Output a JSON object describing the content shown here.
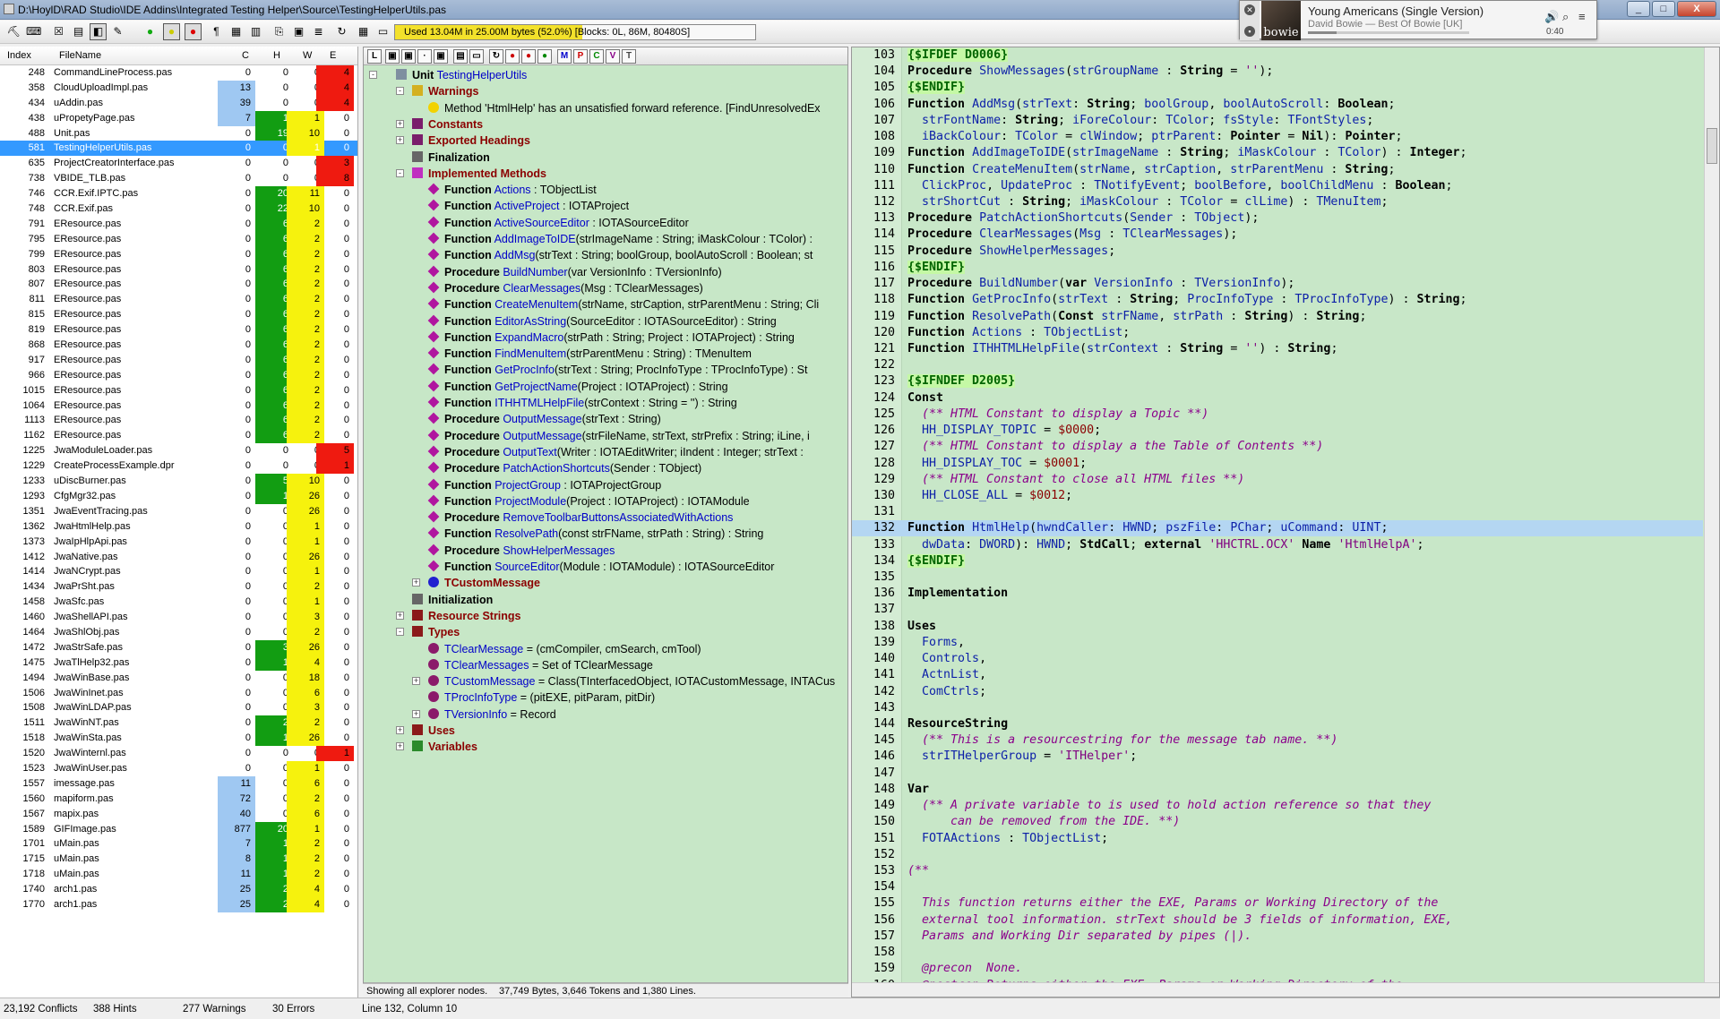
{
  "window": {
    "title": "D:\\HoylD\\RAD Studio\\IDE Addins\\Integrated Testing Helper\\Source\\TestingHelperUtils.pas",
    "controls": [
      "_",
      "□",
      "X"
    ]
  },
  "media": {
    "song": "Young Americans (Single Version)",
    "artist": "David Bowie — Best Of Bowie [UK]",
    "time": "0:40",
    "art_text": "bowie",
    "progress": 0.18
  },
  "memory": {
    "text": "Used 13.04M in 25.00M bytes (52.0%) [Blocks: 0L, 86M, 80480S]",
    "fill": 0.52
  },
  "table": {
    "headers": [
      "Index",
      "FileName",
      "C",
      "H",
      "W",
      "E"
    ],
    "rows": [
      [
        "248",
        "CommandLineProcess.pas",
        "0",
        "0",
        "0",
        "4"
      ],
      [
        "358",
        "CloudUploadImpl.pas",
        "13",
        "0",
        "0",
        "4"
      ],
      [
        "434",
        "uAddin.pas",
        "39",
        "0",
        "0",
        "4"
      ],
      [
        "438",
        "uPropetyPage.pas",
        "7",
        "1",
        "1",
        "0"
      ],
      [
        "488",
        "Unit.pas",
        "0",
        "19",
        "10",
        "0"
      ],
      [
        "581",
        "TestingHelperUtils.pas",
        "0",
        "0",
        "1",
        "0"
      ],
      [
        "635",
        "ProjectCreatorInterface.pas",
        "0",
        "0",
        "0",
        "3"
      ],
      [
        "738",
        "VBIDE_TLB.pas",
        "0",
        "0",
        "0",
        "8"
      ],
      [
        "746",
        "CCR.Exif.IPTC.pas",
        "0",
        "20",
        "11",
        "0"
      ],
      [
        "748",
        "CCR.Exif.pas",
        "0",
        "22",
        "10",
        "0"
      ],
      [
        "791",
        "EResource.pas",
        "0",
        "6",
        "2",
        "0"
      ],
      [
        "795",
        "EResource.pas",
        "0",
        "6",
        "2",
        "0"
      ],
      [
        "799",
        "EResource.pas",
        "0",
        "6",
        "2",
        "0"
      ],
      [
        "803",
        "EResource.pas",
        "0",
        "6",
        "2",
        "0"
      ],
      [
        "807",
        "EResource.pas",
        "0",
        "6",
        "2",
        "0"
      ],
      [
        "811",
        "EResource.pas",
        "0",
        "6",
        "2",
        "0"
      ],
      [
        "815",
        "EResource.pas",
        "0",
        "6",
        "2",
        "0"
      ],
      [
        "819",
        "EResource.pas",
        "0",
        "6",
        "2",
        "0"
      ],
      [
        "868",
        "EResource.pas",
        "0",
        "6",
        "2",
        "0"
      ],
      [
        "917",
        "EResource.pas",
        "0",
        "6",
        "2",
        "0"
      ],
      [
        "966",
        "EResource.pas",
        "0",
        "6",
        "2",
        "0"
      ],
      [
        "1015",
        "EResource.pas",
        "0",
        "6",
        "2",
        "0"
      ],
      [
        "1064",
        "EResource.pas",
        "0",
        "6",
        "2",
        "0"
      ],
      [
        "1113",
        "EResource.pas",
        "0",
        "6",
        "2",
        "0"
      ],
      [
        "1162",
        "EResource.pas",
        "0",
        "6",
        "2",
        "0"
      ],
      [
        "1225",
        "JwaModuleLoader.pas",
        "0",
        "0",
        "0",
        "5"
      ],
      [
        "1229",
        "CreateProcessExample.dpr",
        "0",
        "0",
        "0",
        "1"
      ],
      [
        "1233",
        "uDiscBurner.pas",
        "0",
        "5",
        "10",
        "0"
      ],
      [
        "1293",
        "CfgMgr32.pas",
        "0",
        "1",
        "26",
        "0"
      ],
      [
        "1351",
        "JwaEventTracing.pas",
        "0",
        "0",
        "26",
        "0"
      ],
      [
        "1362",
        "JwaHtmlHelp.pas",
        "0",
        "0",
        "1",
        "0"
      ],
      [
        "1373",
        "JwaIpHlpApi.pas",
        "0",
        "0",
        "1",
        "0"
      ],
      [
        "1412",
        "JwaNative.pas",
        "0",
        "0",
        "26",
        "0"
      ],
      [
        "1414",
        "JwaNCrypt.pas",
        "0",
        "0",
        "1",
        "0"
      ],
      [
        "1434",
        "JwaPrSht.pas",
        "0",
        "0",
        "2",
        "0"
      ],
      [
        "1458",
        "JwaSfc.pas",
        "0",
        "0",
        "1",
        "0"
      ],
      [
        "1460",
        "JwaShellAPI.pas",
        "0",
        "0",
        "3",
        "0"
      ],
      [
        "1464",
        "JwaShlObj.pas",
        "0",
        "0",
        "2",
        "0"
      ],
      [
        "1472",
        "JwaStrSafe.pas",
        "0",
        "3",
        "26",
        "0"
      ],
      [
        "1475",
        "JwaTlHelp32.pas",
        "0",
        "1",
        "4",
        "0"
      ],
      [
        "1494",
        "JwaWinBase.pas",
        "0",
        "0",
        "18",
        "0"
      ],
      [
        "1506",
        "JwaWinInet.pas",
        "0",
        "0",
        "6",
        "0"
      ],
      [
        "1508",
        "JwaWinLDAP.pas",
        "0",
        "0",
        "3",
        "0"
      ],
      [
        "1511",
        "JwaWinNT.pas",
        "0",
        "2",
        "2",
        "0"
      ],
      [
        "1518",
        "JwaWinSta.pas",
        "0",
        "1",
        "26",
        "0"
      ],
      [
        "1520",
        "JwaWinternl.pas",
        "0",
        "0",
        "0",
        "1"
      ],
      [
        "1523",
        "JwaWinUser.pas",
        "0",
        "0",
        "1",
        "0"
      ],
      [
        "1557",
        "imessage.pas",
        "11",
        "0",
        "6",
        "0"
      ],
      [
        "1560",
        "mapiform.pas",
        "72",
        "0",
        "2",
        "0"
      ],
      [
        "1567",
        "mapix.pas",
        "40",
        "0",
        "6",
        "0"
      ],
      [
        "1589",
        "GIFImage.pas",
        "877",
        "20",
        "1",
        "0"
      ],
      [
        "1701",
        "uMain.pas",
        "7",
        "1",
        "2",
        "0"
      ],
      [
        "1715",
        "uMain.pas",
        "8",
        "1",
        "2",
        "0"
      ],
      [
        "1718",
        "uMain.pas",
        "11",
        "1",
        "2",
        "0"
      ],
      [
        "1740",
        "arch1.pas",
        "25",
        "2",
        "4",
        "0"
      ],
      [
        "1770",
        "arch1.pas",
        "25",
        "2",
        "4",
        "0"
      ]
    ],
    "selected_index": "581"
  },
  "tree": {
    "toolbar_buttons": [
      "M",
      "P",
      "C",
      "V",
      "T"
    ],
    "root": {
      "kw": "Unit",
      "name": "TestingHelperUtils"
    },
    "nodes": [
      {
        "level": 1,
        "kind": "head",
        "text": "Warnings",
        "exp": "-",
        "icon": "folder-warning-icon"
      },
      {
        "level": 2,
        "kind": "warn",
        "text": "Method 'HtmlHelp' has an unsatisfied forward reference. [FindUnresolvedEx",
        "icon": "warning-icon"
      },
      {
        "level": 1,
        "kind": "head",
        "text": "Constants",
        "exp": "+",
        "icon": "constants-icon"
      },
      {
        "level": 1,
        "kind": "head",
        "text": "Exported Headings",
        "exp": "+",
        "icon": "exported-icon"
      },
      {
        "level": 1,
        "kind": "plain",
        "text": "Finalization",
        "exp": "",
        "icon": "finalization-icon"
      },
      {
        "level": 1,
        "kind": "head",
        "text": "Implemented Methods",
        "exp": "-",
        "icon": "methods-icon"
      },
      {
        "level": 2,
        "kind": "m",
        "kw": "Function",
        "name": "Actions",
        "rest": " : TObjectList"
      },
      {
        "level": 2,
        "kind": "m",
        "kw": "Function",
        "name": "ActiveProject",
        "rest": " : IOTAProject"
      },
      {
        "level": 2,
        "kind": "m",
        "kw": "Function",
        "name": "ActiveSourceEditor",
        "rest": " : IOTASourceEditor"
      },
      {
        "level": 2,
        "kind": "m",
        "kw": "Function",
        "name": "AddImageToIDE",
        "rest": "(strImageName : String; iMaskColour : TColor) :"
      },
      {
        "level": 2,
        "kind": "m",
        "kw": "Function",
        "name": "AddMsg",
        "rest": "(strText : String; boolGroup, boolAutoScroll : Boolean; st"
      },
      {
        "level": 2,
        "kind": "m",
        "kw": "Procedure",
        "name": "BuildNumber",
        "rest": "(var VersionInfo : TVersionInfo)"
      },
      {
        "level": 2,
        "kind": "m",
        "kw": "Procedure",
        "name": "ClearMessages",
        "rest": "(Msg : TClearMessages)"
      },
      {
        "level": 2,
        "kind": "m",
        "kw": "Function",
        "name": "CreateMenuItem",
        "rest": "(strName, strCaption, strParentMenu : String; Cli"
      },
      {
        "level": 2,
        "kind": "m",
        "kw": "Function",
        "name": "EditorAsString",
        "rest": "(SourceEditor : IOTASourceEditor) : String"
      },
      {
        "level": 2,
        "kind": "m",
        "kw": "Function",
        "name": "ExpandMacro",
        "rest": "(strPath : String; Project : IOTAProject) : String"
      },
      {
        "level": 2,
        "kind": "m",
        "kw": "Function",
        "name": "FindMenuItem",
        "rest": "(strParentMenu : String) : TMenuItem"
      },
      {
        "level": 2,
        "kind": "m",
        "kw": "Function",
        "name": "GetProcInfo",
        "rest": "(strText : String; ProcInfoType : TProcInfoType) : St"
      },
      {
        "level": 2,
        "kind": "m",
        "kw": "Function",
        "name": "GetProjectName",
        "rest": "(Project : IOTAProject) : String"
      },
      {
        "level": 2,
        "kind": "m",
        "kw": "Function",
        "name": "ITHHTMLHelpFile",
        "rest": "(strContext : String = '') : String"
      },
      {
        "level": 2,
        "kind": "m",
        "kw": "Procedure",
        "name": "OutputMessage",
        "rest": "(strText : String)"
      },
      {
        "level": 2,
        "kind": "m",
        "kw": "Procedure",
        "name": "OutputMessage",
        "rest": "(strFileName, strText, strPrefix : String; iLine, i"
      },
      {
        "level": 2,
        "kind": "m",
        "kw": "Procedure",
        "name": "OutputText",
        "rest": "(Writer : IOTAEditWriter; iIndent : Integer; strText :"
      },
      {
        "level": 2,
        "kind": "m",
        "kw": "Procedure",
        "name": "PatchActionShortcuts",
        "rest": "(Sender : TObject)"
      },
      {
        "level": 2,
        "kind": "m",
        "kw": "Function",
        "name": "ProjectGroup",
        "rest": " : IOTAProjectGroup"
      },
      {
        "level": 2,
        "kind": "m",
        "kw": "Function",
        "name": "ProjectModule",
        "rest": "(Project : IOTAProject) : IOTAModule"
      },
      {
        "level": 2,
        "kind": "m",
        "kw": "Procedure",
        "name": "RemoveToolbarButtonsAssociatedWithActions",
        "rest": ""
      },
      {
        "level": 2,
        "kind": "m",
        "kw": "Function",
        "name": "ResolvePath",
        "rest": "(const strFName, strPath : String) : String"
      },
      {
        "level": 2,
        "kind": "m",
        "kw": "Procedure",
        "name": "ShowHelperMessages",
        "rest": ""
      },
      {
        "level": 2,
        "kind": "m",
        "kw": "Function",
        "name": "SourceEditor",
        "rest": "(Module : IOTAModule) : IOTASourceEditor"
      },
      {
        "level": 2,
        "kind": "head",
        "text": "TCustomMessage",
        "exp": "+",
        "icon": "class-icon"
      },
      {
        "level": 1,
        "kind": "plain",
        "text": "Initialization",
        "exp": "",
        "icon": "initialization-icon"
      },
      {
        "level": 1,
        "kind": "head",
        "text": "Resource Strings",
        "exp": "+",
        "icon": "resource-icon"
      },
      {
        "level": 1,
        "kind": "head",
        "text": "Types",
        "exp": "-",
        "icon": "types-icon"
      },
      {
        "level": 2,
        "kind": "t",
        "name": "TClearMessage",
        "rest": " = (cmCompiler, cmSearch, cmTool)"
      },
      {
        "level": 2,
        "kind": "t",
        "name": "TClearMessages",
        "rest": " = Set of TClearMessage"
      },
      {
        "level": 2,
        "kind": "t",
        "name": "TCustomMessage",
        "rest": " = Class(TInterfacedObject, IOTACustomMessage, INTACus",
        "exp": "+"
      },
      {
        "level": 2,
        "kind": "t",
        "name": "TProcInfoType",
        "rest": " = (pitEXE, pitParam, pitDir)"
      },
      {
        "level": 2,
        "kind": "t",
        "name": "TVersionInfo",
        "rest": " = Record",
        "exp": "+"
      },
      {
        "level": 1,
        "kind": "head",
        "text": "Uses",
        "exp": "+",
        "icon": "uses-icon"
      },
      {
        "level": 1,
        "kind": "head",
        "text": "Variables",
        "exp": "+",
        "icon": "variables-icon"
      }
    ],
    "status": "Showing all explorer nodes."
  },
  "editor": {
    "info": "37,749 Bytes, 3,646 Tokens and 1,380 Lines.",
    "current_line": 132,
    "lines": [
      [
        103,
        "{$IFDEF D0006}"
      ],
      [
        104,
        "Procedure ShowMessages(strGroupName : String = '');"
      ],
      [
        105,
        "{$ENDIF}"
      ],
      [
        106,
        "Function AddMsg(strText: String; boolGroup, boolAutoScroll: Boolean;"
      ],
      [
        107,
        "  strFontName: String; iForeColour: TColor; fsStyle: TFontStyles;"
      ],
      [
        108,
        "  iBackColour: TColor = clWindow; ptrParent: Pointer = Nil): Pointer;"
      ],
      [
        109,
        "Function AddImageToIDE(strImageName : String; iMaskColour : TColor) : Integer;"
      ],
      [
        110,
        "Function CreateMenuItem(strName, strCaption, strParentMenu : String;"
      ],
      [
        111,
        "  ClickProc, UpdateProc : TNotifyEvent; boolBefore, boolChildMenu : Boolean;"
      ],
      [
        112,
        "  strShortCut : String; iMaskColour : TColor = clLime) : TMenuItem;"
      ],
      [
        113,
        "Procedure PatchActionShortcuts(Sender : TObject);"
      ],
      [
        114,
        "Procedure ClearMessages(Msg : TClearMessages);"
      ],
      [
        115,
        "Procedure ShowHelperMessages;"
      ],
      [
        116,
        "{$ENDIF}"
      ],
      [
        117,
        "Procedure BuildNumber(var VersionInfo : TVersionInfo);"
      ],
      [
        118,
        "Function GetProcInfo(strText : String; ProcInfoType : TProcInfoType) : String;"
      ],
      [
        119,
        "Function ResolvePath(Const strFName, strPath : String) : String;"
      ],
      [
        120,
        "Function Actions : TObjectList;"
      ],
      [
        121,
        "Function ITHHTMLHelpFile(strContext : String = '') : String;"
      ],
      [
        122,
        ""
      ],
      [
        123,
        "{$IFNDEF D2005}"
      ],
      [
        124,
        "Const"
      ],
      [
        125,
        "  (** HTML Constant to display a Topic **)"
      ],
      [
        126,
        "  HH_DISPLAY_TOPIC = $0000;"
      ],
      [
        127,
        "  (** HTML Constant to display a the Table of Contents **)"
      ],
      [
        128,
        "  HH_DISPLAY_TOC = $0001;"
      ],
      [
        129,
        "  (** HTML Constant to close all HTML files **)"
      ],
      [
        130,
        "  HH_CLOSE_ALL = $0012;"
      ],
      [
        131,
        ""
      ],
      [
        132,
        "Function HtmlHelp(hwndCaller: HWND; pszFile: PChar; uCommand: UINT;"
      ],
      [
        133,
        "  dwData: DWORD): HWND; StdCall; external 'HHCTRL.OCX' Name 'HtmlHelpA';"
      ],
      [
        134,
        "{$ENDIF}"
      ],
      [
        135,
        ""
      ],
      [
        136,
        "Implementation"
      ],
      [
        137,
        ""
      ],
      [
        138,
        "Uses"
      ],
      [
        139,
        "  Forms,"
      ],
      [
        140,
        "  Controls,"
      ],
      [
        141,
        "  ActnList,"
      ],
      [
        142,
        "  ComCtrls;"
      ],
      [
        143,
        ""
      ],
      [
        144,
        "ResourceString"
      ],
      [
        145,
        "  (** This is a resourcestring for the message tab name. **)"
      ],
      [
        146,
        "  strITHelperGroup = 'ITHelper';"
      ],
      [
        147,
        ""
      ],
      [
        148,
        "Var"
      ],
      [
        149,
        "  (** A private variable to is used to hold action reference so that they"
      ],
      [
        150,
        "      can be removed from the IDE. **)"
      ],
      [
        151,
        "  FOTAActions : TObjectList;"
      ],
      [
        152,
        ""
      ],
      [
        153,
        "(**"
      ],
      [
        154,
        ""
      ],
      [
        155,
        "  This function returns either the EXE, Params or Working Directory of the"
      ],
      [
        156,
        "  external tool information. strText should be 3 fields of information, EXE,"
      ],
      [
        157,
        "  Params and Working Dir separated by pipes (|)."
      ],
      [
        158,
        ""
      ],
      [
        159,
        "  @precon  None."
      ],
      [
        160,
        "  @postcon Returns either the EXE, Params or Working Directory of the"
      ]
    ]
  },
  "status": {
    "conflicts": "23,192 Conflicts",
    "hints": "388 Hints",
    "warnings": "277 Warnings",
    "errors": "30 Errors",
    "position": "Line 132, Column 10"
  }
}
